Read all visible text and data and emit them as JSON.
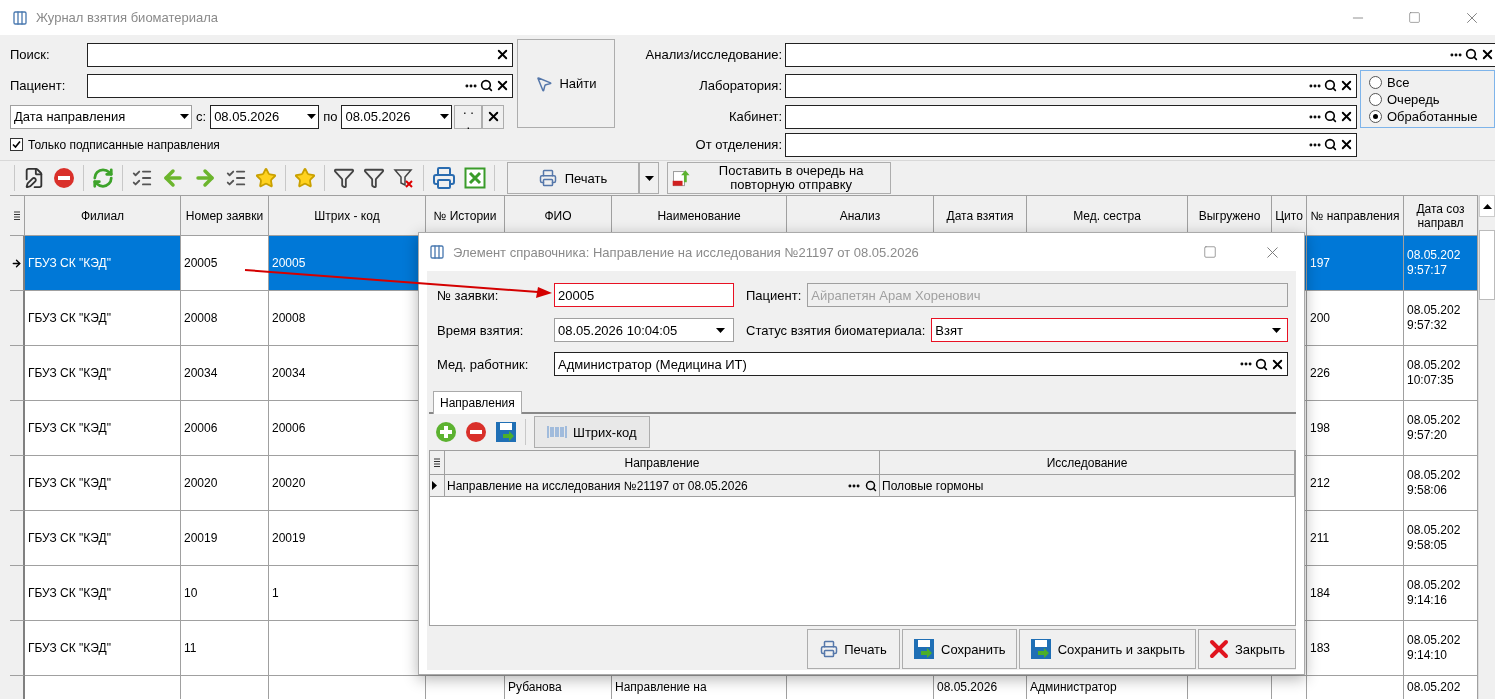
{
  "window": {
    "title": "Журнал взятия биоматериала"
  },
  "filters": {
    "search": {
      "label": "Поиск:"
    },
    "patient": {
      "label": "Пациент:"
    },
    "date": {
      "field": "Дата направления",
      "from_label": "с:",
      "from": "08.05.2026",
      "to_label": "по",
      "to": "08.05.2026",
      "more": ". . ."
    },
    "signed_only": {
      "label": "Только подписанные направления",
      "checked": true
    },
    "find_button": "Найти",
    "lookups": [
      {
        "label": "Анализ/исследование:"
      },
      {
        "label": "Лаборатория:"
      },
      {
        "label": "Кабинет:"
      },
      {
        "label": "От отделения:"
      }
    ],
    "status": [
      {
        "label": "Все",
        "selected": false
      },
      {
        "label": "Очередь",
        "selected": false
      },
      {
        "label": "Обработанные",
        "selected": true
      }
    ]
  },
  "toolbar": {
    "print": "Печать",
    "requeue": "Поставить в очередь на повторную отправку"
  },
  "table": {
    "columns": [
      {
        "label": "Филиал"
      },
      {
        "label": "Номер заявки"
      },
      {
        "label": "Штрих - код"
      },
      {
        "label": "№ Истории"
      },
      {
        "label": "ФИО"
      },
      {
        "label": "Наименование"
      },
      {
        "label": "Анализ"
      },
      {
        "label": "Дата взятия"
      },
      {
        "label": "Мед. сестра"
      },
      {
        "label": "Выгружено"
      },
      {
        "label": "Цито"
      },
      {
        "label": "№ направления"
      },
      {
        "label": "Дата соз направл"
      }
    ],
    "rows": [
      {
        "selected": true,
        "current": true,
        "cells": [
          "ГБУЗ СК \"КЭД\"",
          {
            "text": "20005",
            "focused": true
          },
          "20005",
          null,
          null,
          null,
          null,
          null,
          null,
          null,
          null,
          "197",
          "08.05.202 9:57:17"
        ]
      },
      {
        "selected": false,
        "current": false,
        "cells": [
          "ГБУЗ СК \"КЭД\"",
          "20008",
          "20008",
          null,
          null,
          null,
          null,
          null,
          null,
          null,
          null,
          "200",
          "08.05.202 9:57:32"
        ]
      },
      {
        "selected": false,
        "current": false,
        "cells": [
          "ГБУЗ СК \"КЭД\"",
          "20034",
          "20034",
          null,
          null,
          null,
          null,
          null,
          null,
          null,
          null,
          "226",
          "08.05.202 10:07:35"
        ]
      },
      {
        "selected": false,
        "current": false,
        "cells": [
          "ГБУЗ СК \"КЭД\"",
          "20006",
          "20006",
          null,
          null,
          null,
          null,
          null,
          null,
          null,
          null,
          "198",
          "08.05.202 9:57:20"
        ]
      },
      {
        "selected": false,
        "current": false,
        "cells": [
          "ГБУЗ СК \"КЭД\"",
          "20020",
          "20020",
          null,
          null,
          null,
          null,
          null,
          null,
          null,
          null,
          "212",
          "08.05.202 9:58:06"
        ]
      },
      {
        "selected": false,
        "current": false,
        "cells": [
          "ГБУЗ СК \"КЭД\"",
          "20019",
          "20019",
          null,
          null,
          null,
          null,
          null,
          null,
          null,
          null,
          "211",
          "08.05.202 9:58:05"
        ]
      },
      {
        "selected": false,
        "current": false,
        "cells": [
          "ГБУЗ СК \"КЭД\"",
          "10",
          "1",
          null,
          null,
          null,
          null,
          null,
          null,
          null,
          null,
          "184",
          "08.05.202 9:14:16"
        ]
      },
      {
        "selected": false,
        "current": false,
        "cells": [
          "ГБУЗ СК \"КЭД\"",
          "11",
          null,
          null,
          null,
          null,
          null,
          null,
          null,
          null,
          null,
          "183",
          "08.05.202 9:14:10"
        ]
      },
      {
        "selected": false,
        "current": false,
        "cells": [
          null,
          null,
          null,
          null,
          "Рубанова",
          "Направление на",
          null,
          "08.05.2026",
          "Администратор",
          null,
          null,
          null,
          "08.05.202"
        ]
      }
    ]
  },
  "dialog": {
    "title": "Элемент справочника: Направление на исследования №21197 от 08.05.2026",
    "order": {
      "label": "№ заявки:",
      "value": "20005",
      "invalid": true
    },
    "patient": {
      "label": "Пациент:",
      "value": "Айрапетян Арам Хоренович",
      "disabled": true
    },
    "taken_at": {
      "label": "Время взятия:",
      "value": "08.05.2026 10:04:05"
    },
    "status": {
      "label": "Статус взятия биоматериала:",
      "value": "Взят",
      "invalid": true
    },
    "worker": {
      "label": "Мед. работник:",
      "value": "Администратор (Медицина ИТ)"
    },
    "tabs": [
      {
        "label": "Направления",
        "selected": true
      }
    ],
    "barcode_button": "Штрих-код",
    "grid": {
      "columns": [
        "Направление",
        "Исследование"
      ],
      "rows": [
        {
          "current": true,
          "cells": [
            "Направление на исследования №21197 от 08.05.2026",
            "Половые гормоны"
          ]
        }
      ]
    },
    "buttons": [
      {
        "label": "Печать",
        "kind": "print"
      },
      {
        "label": "Сохранить",
        "kind": "save"
      },
      {
        "label": "Сохранить и закрыть",
        "kind": "save"
      },
      {
        "label": "Закрыть",
        "kind": "close"
      }
    ]
  }
}
